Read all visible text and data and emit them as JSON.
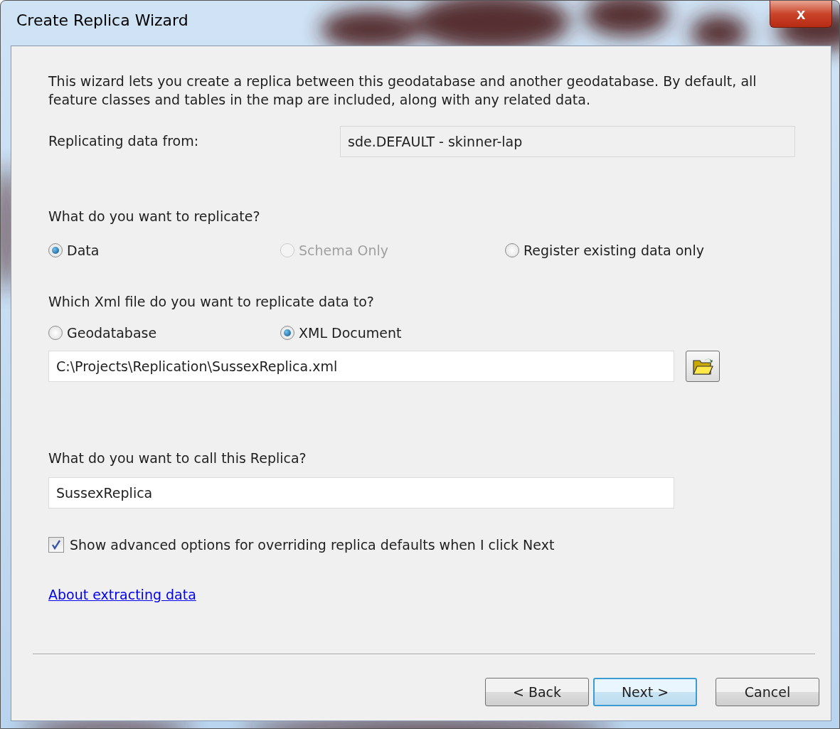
{
  "window": {
    "title": "Create Replica Wizard",
    "close": "x"
  },
  "intro": "This wizard lets you create a replica between this geodatabase  and another geodatabase. By default, all feature classes and tables in the map are included, along with any related data.",
  "source": {
    "label": "Replicating data from:",
    "value": "sde.DEFAULT - skinner-lap"
  },
  "replicate": {
    "question": "What do you want to replicate?",
    "options": [
      {
        "label": "Data",
        "selected": true,
        "disabled": false
      },
      {
        "label": "Schema Only",
        "selected": false,
        "disabled": true
      },
      {
        "label": "Register existing data only",
        "selected": false,
        "disabled": false
      }
    ]
  },
  "target": {
    "question": "Which Xml file do you want to replicate data to?",
    "options": [
      {
        "label": "Geodatabase",
        "selected": false,
        "disabled": false
      },
      {
        "label": "XML Document",
        "selected": true,
        "disabled": false
      }
    ],
    "path": "C:\\Projects\\Replication\\SussexReplica.xml"
  },
  "name": {
    "question": "What do you want to call this Replica?",
    "value": "SussexReplica"
  },
  "advanced": {
    "label": "Show advanced options for overriding replica defaults when I click Next",
    "checked": true
  },
  "link": "About extracting data",
  "buttons": [
    {
      "label": "< Back",
      "default": false
    },
    {
      "label": "Next >",
      "default": true
    },
    {
      "label": "Cancel",
      "default": false
    }
  ]
}
